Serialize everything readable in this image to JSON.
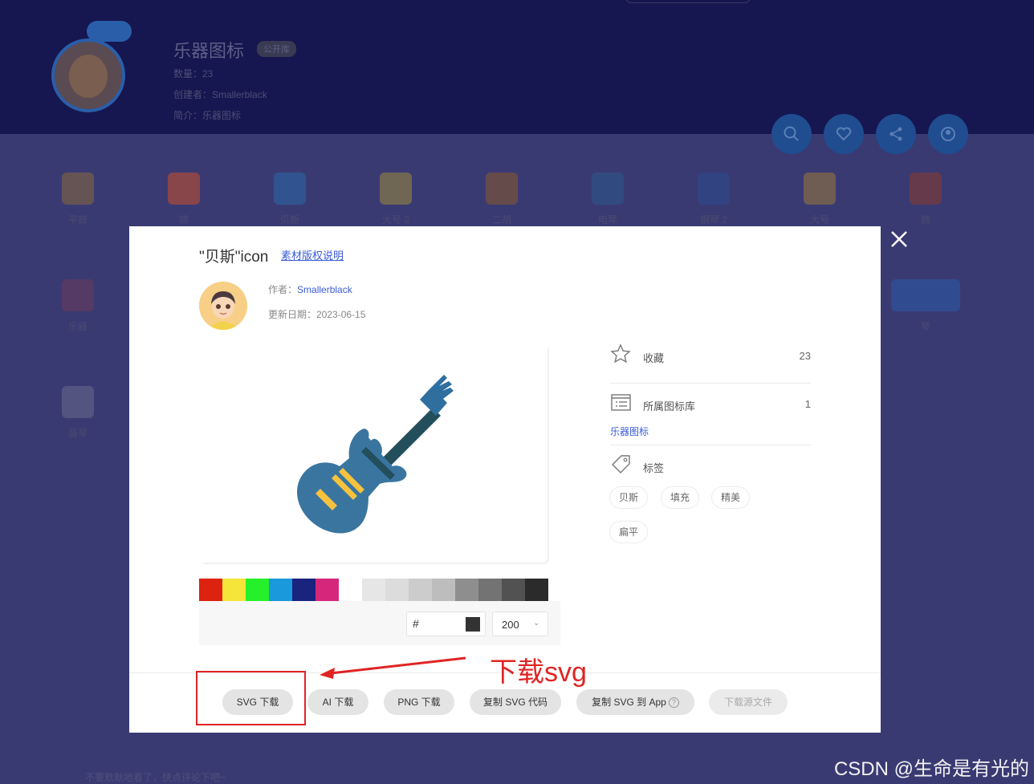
{
  "collection": {
    "title": "乐器图标",
    "badge": "公开库",
    "count_label": "数量：23",
    "creator_label": "创建者：Smallerblack",
    "intro_label": "简介：乐器图标"
  },
  "grid_icons": [
    {
      "label": "平鼓",
      "color": "#8a6a3a"
    },
    {
      "label": "镲",
      "color": "#c8502a"
    },
    {
      "label": "贝斯",
      "color": "#2a6aa8"
    },
    {
      "label": "大号 2",
      "color": "#9a8a3a"
    },
    {
      "label": "二胡",
      "color": "#8a5a2a"
    },
    {
      "label": "电琴",
      "color": "#2a5a8a"
    },
    {
      "label": "钢琴 2",
      "color": "#2a4a8a"
    },
    {
      "label": "大号",
      "color": "#9a7a3a"
    },
    {
      "label": "鼓",
      "color": "#8a3a2a"
    },
    {
      "label": "乐器",
      "color": "#6a3a5a"
    },
    {
      "label": "琴",
      "color": "#2a5aa8"
    },
    {
      "label": "竖琴",
      "color": "#6a6a8a"
    }
  ],
  "modal": {
    "title": "\"贝斯\"icon",
    "copyright_link": "素材版权说明",
    "author_prefix": "作者：",
    "author_name": "Smallerblack",
    "updated": "更新日期：2023-06-15",
    "palette": [
      "#dd2210",
      "#f5e53a",
      "#25f02a",
      "#1a99dc",
      "#1a237e",
      "#d6267b",
      "#ffffff",
      "#e6e6e6",
      "#dcdcdc",
      "#cccccc",
      "#bdbdbd",
      "#8e8e8e",
      "#737373",
      "#525252",
      "#2b2b2b"
    ],
    "hex_prefix": "#",
    "current_color": "#333333",
    "size_value": "200",
    "favorite_label": "收藏",
    "favorite_count": "23",
    "library_label": "所属图标库",
    "library_count": "1",
    "library_link": "乐器图标",
    "tags_label": "标签",
    "tags": [
      "贝斯",
      "填充",
      "精美",
      "扁平"
    ],
    "buttons": {
      "svg_download": "SVG 下载",
      "ai_download": "AI 下载",
      "png_download": "PNG 下载",
      "copy_svg_code": "复制 SVG 代码",
      "copy_svg_to_app": "复制 SVG 到 App",
      "help_mark": "?",
      "download_source": "下载源文件"
    }
  },
  "annotation": {
    "text": "下载svg"
  },
  "footer_note": "不要默默地看了，快点评论下吧~",
  "watermark": "CSDN @生命是有光的"
}
